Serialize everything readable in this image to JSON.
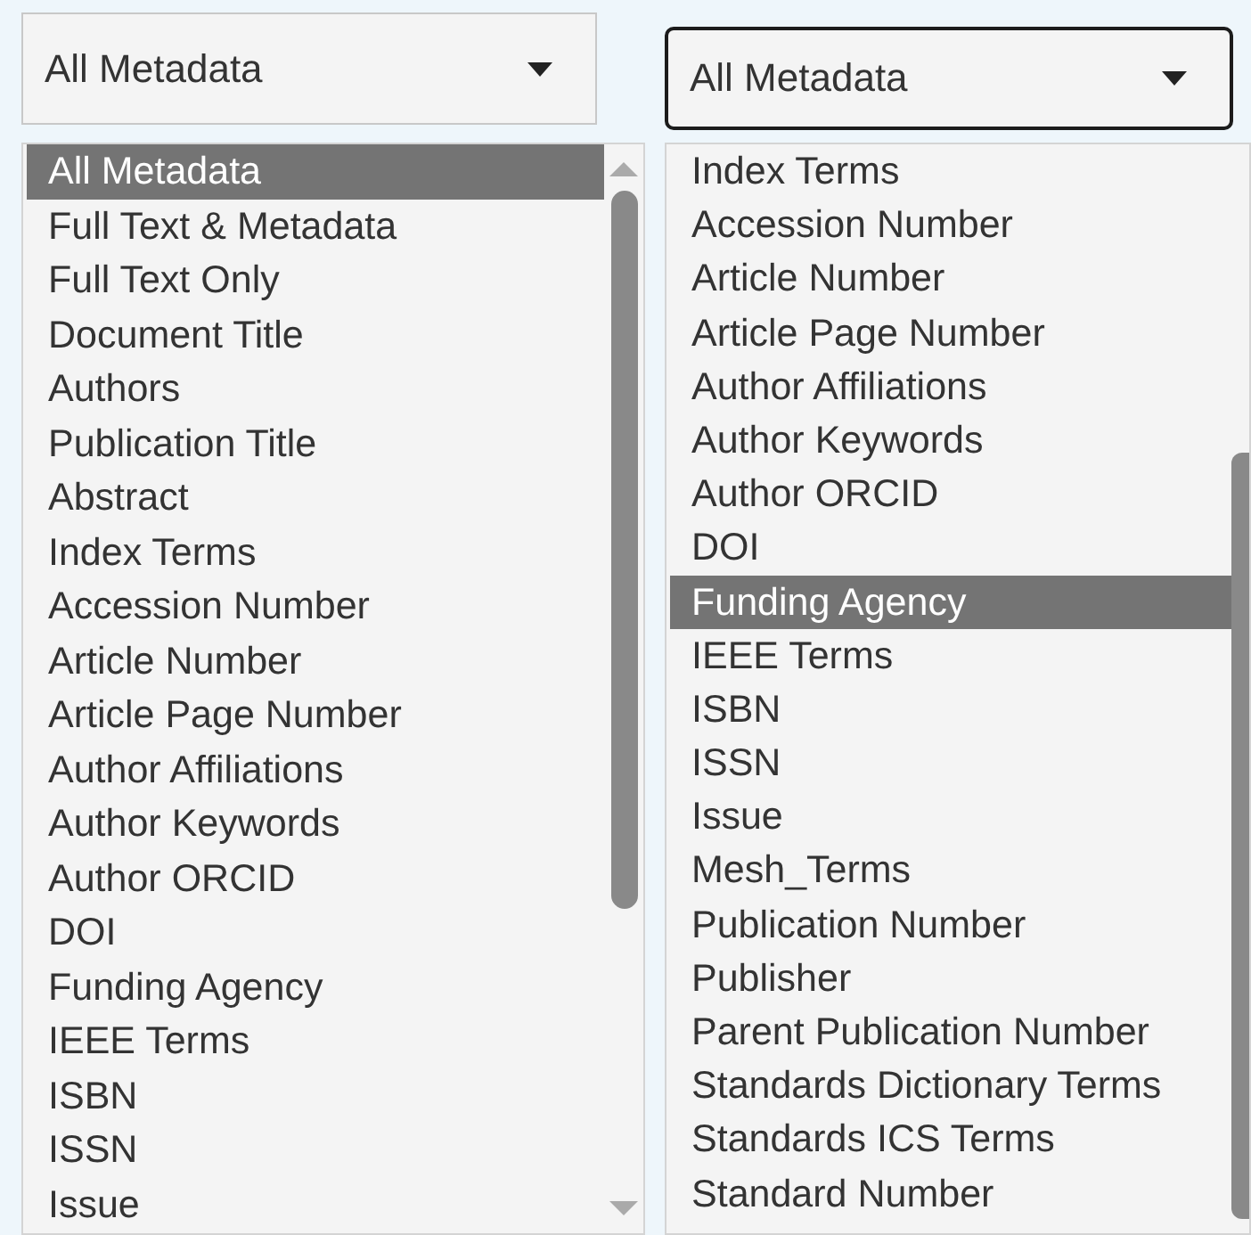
{
  "panels": [
    {
      "select": {
        "value": "All Metadata",
        "focused": false
      },
      "options": [
        {
          "label": "All Metadata",
          "selected": true
        },
        {
          "label": "Full Text & Metadata",
          "selected": false
        },
        {
          "label": "Full Text Only",
          "selected": false
        },
        {
          "label": "Document Title",
          "selected": false
        },
        {
          "label": "Authors",
          "selected": false
        },
        {
          "label": "Publication Title",
          "selected": false
        },
        {
          "label": "Abstract",
          "selected": false
        },
        {
          "label": "Index Terms",
          "selected": false
        },
        {
          "label": "Accession Number",
          "selected": false
        },
        {
          "label": "Article Number",
          "selected": false
        },
        {
          "label": "Article Page Number",
          "selected": false
        },
        {
          "label": "Author Affiliations",
          "selected": false
        },
        {
          "label": "Author Keywords",
          "selected": false
        },
        {
          "label": "Author ORCID",
          "selected": false
        },
        {
          "label": "DOI",
          "selected": false
        },
        {
          "label": "Funding Agency",
          "selected": false
        },
        {
          "label": "IEEE Terms",
          "selected": false
        },
        {
          "label": "ISBN",
          "selected": false
        },
        {
          "label": "ISSN",
          "selected": false
        },
        {
          "label": "Issue",
          "selected": false
        }
      ]
    },
    {
      "select": {
        "value": "All Metadata",
        "focused": true
      },
      "options": [
        {
          "label": "Index Terms",
          "selected": false
        },
        {
          "label": "Accession Number",
          "selected": false
        },
        {
          "label": "Article Number",
          "selected": false
        },
        {
          "label": "Article Page Number",
          "selected": false
        },
        {
          "label": "Author Affiliations",
          "selected": false
        },
        {
          "label": "Author Keywords",
          "selected": false
        },
        {
          "label": "Author ORCID",
          "selected": false
        },
        {
          "label": "DOI",
          "selected": false
        },
        {
          "label": "Funding Agency",
          "selected": true
        },
        {
          "label": "IEEE Terms",
          "selected": false
        },
        {
          "label": "ISBN",
          "selected": false
        },
        {
          "label": "ISSN",
          "selected": false
        },
        {
          "label": "Issue",
          "selected": false
        },
        {
          "label": "Mesh_Terms",
          "selected": false
        },
        {
          "label": "Publication Number",
          "selected": false
        },
        {
          "label": "Publisher",
          "selected": false
        },
        {
          "label": "Parent Publication Number",
          "selected": false
        },
        {
          "label": "Standards Dictionary Terms",
          "selected": false
        },
        {
          "label": "Standards ICS Terms",
          "selected": false
        },
        {
          "label": "Standard Number",
          "selected": false
        }
      ]
    }
  ]
}
